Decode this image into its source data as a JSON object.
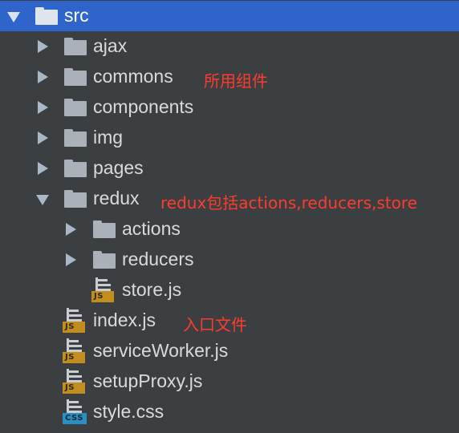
{
  "tree": {
    "root": {
      "label": "src",
      "expanded": true
    },
    "items": [
      {
        "label": "ajax",
        "type": "folder",
        "expanded": false
      },
      {
        "label": "commons",
        "type": "folder",
        "expanded": false,
        "note": "所用组件"
      },
      {
        "label": "components",
        "type": "folder",
        "expanded": false
      },
      {
        "label": "img",
        "type": "folder",
        "expanded": false
      },
      {
        "label": "pages",
        "type": "folder",
        "expanded": false
      },
      {
        "label": "redux",
        "type": "folder",
        "expanded": true,
        "note": "redux包括actions,reducers,store"
      },
      {
        "label": "actions",
        "type": "folder",
        "expanded": false
      },
      {
        "label": "reducers",
        "type": "folder",
        "expanded": false
      },
      {
        "label": "store.js",
        "type": "file",
        "badge": "JS"
      },
      {
        "label": "index.js",
        "type": "file",
        "badge": "JS",
        "note": "入口文件"
      },
      {
        "label": "serviceWorker.js",
        "type": "file",
        "badge": "JS"
      },
      {
        "label": "setupProxy.js",
        "type": "file",
        "badge": "JS"
      },
      {
        "label": "style.css",
        "type": "file",
        "badge": "CSS"
      }
    ]
  },
  "colors": {
    "background": "#3c3f41",
    "selection": "#2f65ca",
    "annotation": "#ff3b2f",
    "js_badge": "#c38d1e",
    "css_badge": "#2a8fc2"
  }
}
